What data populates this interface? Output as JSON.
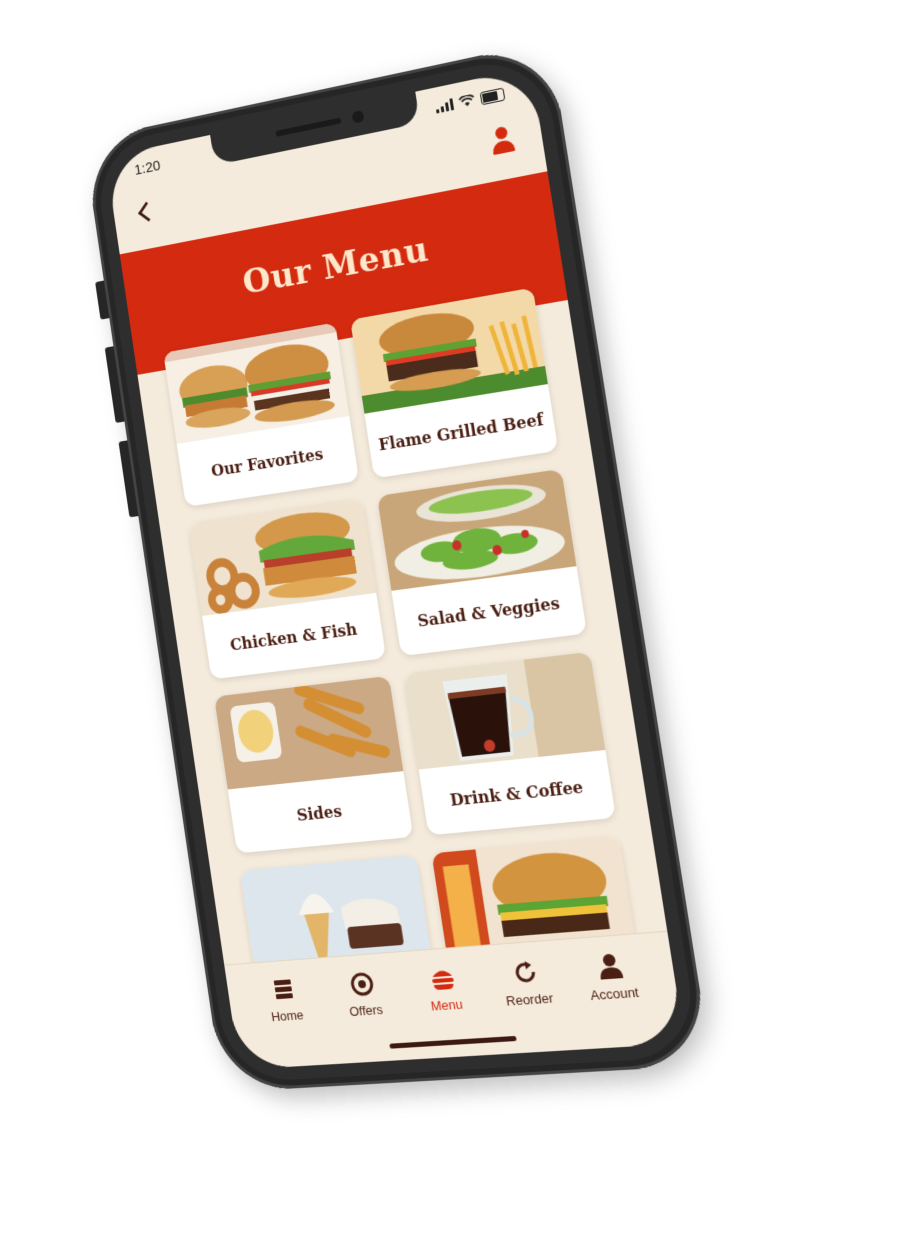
{
  "status_bar": {
    "time": "1:20"
  },
  "header": {
    "title": "Our Menu"
  },
  "categories": [
    {
      "label": "Our Favorites"
    },
    {
      "label": "Flame Grilled Beef"
    },
    {
      "label": "Chicken & Fish"
    },
    {
      "label": "Salad & Veggies"
    },
    {
      "label": "Sides"
    },
    {
      "label": "Drink & Coffee"
    }
  ],
  "tabs": [
    {
      "label": "Home",
      "icon": "home-icon",
      "active": false
    },
    {
      "label": "Offers",
      "icon": "offers-icon",
      "active": false
    },
    {
      "label": "Menu",
      "icon": "burger-menu-icon",
      "active": true
    },
    {
      "label": "Reorder",
      "icon": "reorder-icon",
      "active": false
    },
    {
      "label": "Account",
      "icon": "account-icon",
      "active": false
    }
  ],
  "colors": {
    "brand_red": "#d42a10",
    "cream": "#f5ebdc",
    "dark_brown": "#4a1e12",
    "phone_body": "#2e2e2e"
  }
}
